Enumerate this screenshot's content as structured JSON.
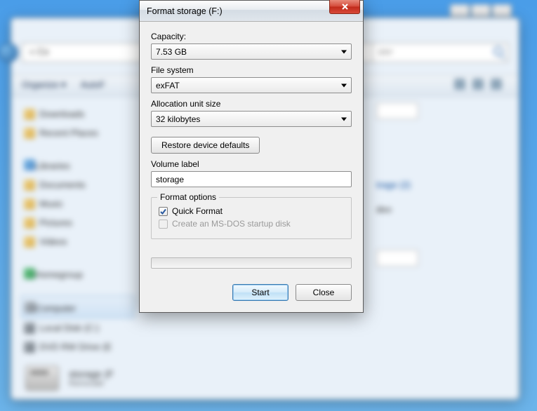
{
  "dialog": {
    "title": "Format storage (F:)",
    "capacity": {
      "label": "Capacity:",
      "value": "7.53 GB"
    },
    "filesystem": {
      "label": "File system",
      "value": "exFAT"
    },
    "allocation": {
      "label": "Allocation unit size",
      "value": "32 kilobytes"
    },
    "restore_label": "Restore device defaults",
    "volume": {
      "label": "Volume label",
      "value": "storage"
    },
    "format_options": {
      "legend": "Format options",
      "quick_format": "Quick Format",
      "msdos": "Create an MS-DOS startup disk"
    },
    "buttons": {
      "start": "Start",
      "close": "Close"
    }
  },
  "background": {
    "address_prefix": "« Co",
    "search_placeholder": "ster",
    "organize": "Organize ▾",
    "autof": "AutoF",
    "sidebar": {
      "downloads": "Downloads",
      "recent": "Recent Places",
      "libraries": "Libraries",
      "documents": "Documents",
      "music": "Music",
      "pictures": "Pictures",
      "videos": "Videos",
      "homegroup": "Homegroup",
      "computer": "Computer",
      "localdisk": "Local Disk (C:)",
      "dvd": "DVD RW Drive (E"
    },
    "content": {
      "drives_link": "trage (2)",
      "dev": "deo"
    },
    "bottombar": {
      "title": "storage (F",
      "sub": "Removabl"
    }
  }
}
